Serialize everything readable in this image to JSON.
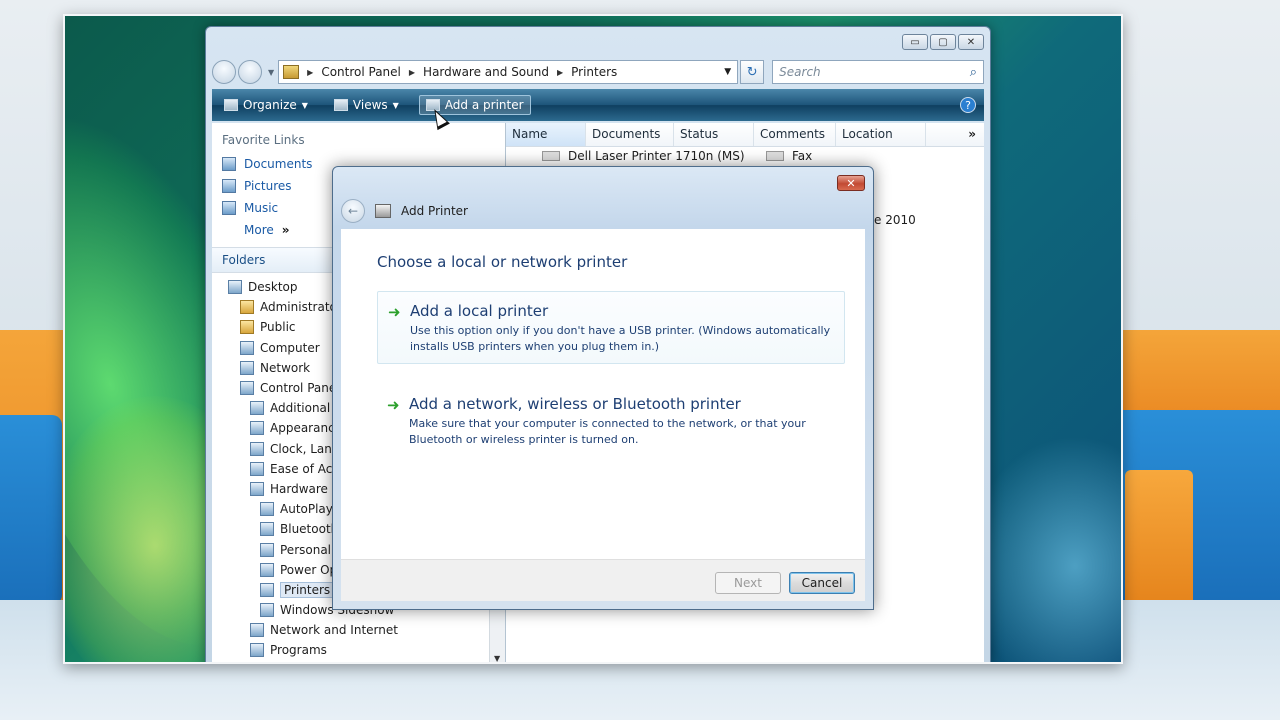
{
  "explorer": {
    "window_buttons": {
      "minimize": "▭",
      "maximize": "▢",
      "close": "✕"
    },
    "breadcrumbs": [
      "Control Panel",
      "Hardware and Sound",
      "Printers"
    ],
    "search_placeholder": "Search",
    "toolbar": {
      "organize": "Organize",
      "views": "Views",
      "add_printer": "Add a printer",
      "help": "?"
    },
    "favorite_links_header": "Favorite Links",
    "favorite_links": [
      "Documents",
      "Pictures",
      "Music"
    ],
    "more_label": "More",
    "more_glyph": "»",
    "folders_header": "Folders",
    "tree": [
      {
        "label": "Desktop",
        "indent": 0,
        "type": "desktop"
      },
      {
        "label": "Administrator",
        "indent": 1,
        "type": "folder"
      },
      {
        "label": "Public",
        "indent": 1,
        "type": "folder"
      },
      {
        "label": "Computer",
        "indent": 1,
        "type": "computer"
      },
      {
        "label": "Network",
        "indent": 1,
        "type": "network"
      },
      {
        "label": "Control Panel",
        "indent": 1,
        "type": "control-panel"
      },
      {
        "label": "Additional O",
        "indent": 2,
        "type": "item"
      },
      {
        "label": "Appearance",
        "indent": 2,
        "type": "item"
      },
      {
        "label": "Clock, Lang",
        "indent": 2,
        "type": "item"
      },
      {
        "label": "Ease of Acce",
        "indent": 2,
        "type": "item"
      },
      {
        "label": "Hardware ar",
        "indent": 2,
        "type": "item"
      },
      {
        "label": "AutoPlay",
        "indent": 3,
        "type": "item"
      },
      {
        "label": "Bluetooth",
        "indent": 3,
        "type": "item"
      },
      {
        "label": "Personaliz",
        "indent": 3,
        "type": "item"
      },
      {
        "label": "Power Opt",
        "indent": 3,
        "type": "item"
      },
      {
        "label": "Printers",
        "indent": 3,
        "type": "printer",
        "selected": true
      },
      {
        "label": "Windows Sideshow",
        "indent": 3,
        "type": "item"
      },
      {
        "label": "Network and Internet",
        "indent": 2,
        "type": "item"
      },
      {
        "label": "Programs",
        "indent": 2,
        "type": "item"
      }
    ],
    "columns": [
      "Name",
      "Documents",
      "Status",
      "Comments",
      "Location"
    ],
    "columns_more": "»",
    "printers": [
      {
        "name": "Dell Laser Printer 1710n (MS)"
      },
      {
        "name": "Fax"
      }
    ],
    "date_fragment": "e 2010"
  },
  "dialog": {
    "title": "Add Printer",
    "close_glyph": "✕",
    "heading": "Choose a local or network printer",
    "options": [
      {
        "title": "Add a local printer",
        "description": "Use this option only if you don't have a USB printer. (Windows automatically installs USB printers when you plug them in.)"
      },
      {
        "title": "Add a network, wireless or Bluetooth printer",
        "description": "Make sure that your computer is connected to the network, or that your Bluetooth or wireless printer is turned on."
      }
    ],
    "next_label": "Next",
    "cancel_label": "Cancel"
  }
}
